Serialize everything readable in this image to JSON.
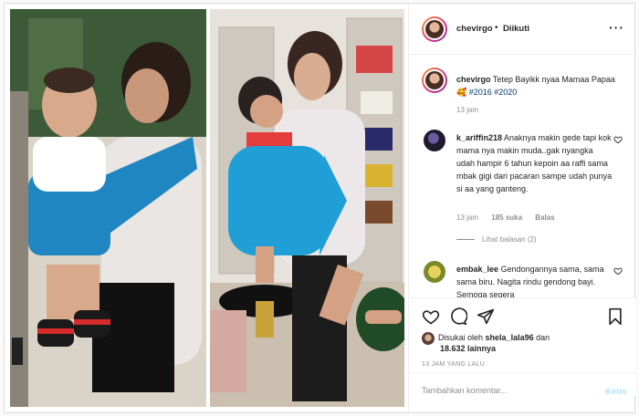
{
  "post": {
    "username": "chevirgo",
    "follow_status": "Diikuti",
    "separator": "•",
    "caption_text": "Tetep Bayikk nyaa Mamaa Papaa 🥰",
    "caption_tags": "#2016 #2020",
    "caption_time": "13 jam",
    "more_icon": "more-horizontal-icon"
  },
  "comments": [
    {
      "username": "k_ariffin218",
      "text": "Anaknya makin gede tapi kok mama nya makin muda..gak nyangka udah hampir 6 tahun kepoin aa raffi sama mbak gigi dari pacaran sampe udah punya si aa yang ganteng.",
      "time": "13 jam",
      "likes": "185 suka",
      "reply": "Balas",
      "view_replies": "Lihat balasan (2)"
    },
    {
      "username": "embak_lee",
      "text": "Gendongannya sama, sama sama biru. Nagita rindu gendong bayi. Semoga segera",
      "time": "",
      "likes": "",
      "reply": ""
    }
  ],
  "actions": {
    "liked_by_prefix": "Disukai oleh",
    "liked_by_user": "shela_lala96",
    "liked_by_and": "dan",
    "liked_by_count": "18.632 lainnya",
    "post_time": "13 JAM YANG LALU"
  },
  "comment_box": {
    "placeholder": "Tambahkan komentar...",
    "send_label": "Kirim"
  },
  "colors": {
    "accent_link": "#00376b",
    "muted": "#8e8e8e",
    "send_disabled": "#b2dffc",
    "carrier_blue": "#1f9fd6"
  }
}
